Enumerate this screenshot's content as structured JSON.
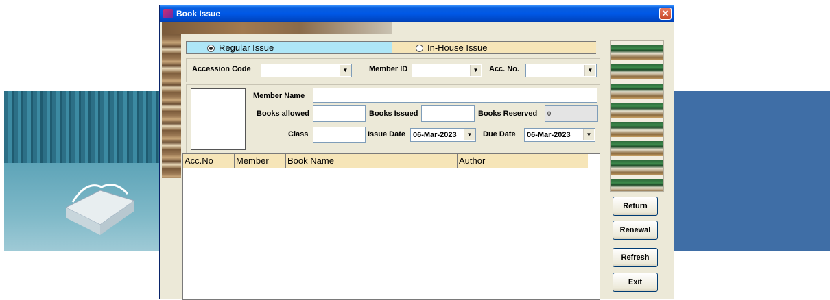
{
  "window": {
    "title": "Book Issue",
    "close_glyph": "✕"
  },
  "issue_type": {
    "regular_label": "Regular Issue",
    "inhouse_label": "In-House Issue",
    "selected": "Regular Issue"
  },
  "lookup": {
    "accession_code_label": "Accession Code",
    "accession_code_value": "",
    "member_id_label": "Member ID",
    "member_id_value": "",
    "acc_no_label": "Acc. No.",
    "acc_no_value": ""
  },
  "member": {
    "member_name_label": "Member Name",
    "member_name_value": "",
    "books_allowed_label": "Books allowed",
    "books_allowed_value": "",
    "books_issued_label": "Books Issued",
    "books_issued_value": "",
    "books_reserved_label": "Books Reserved",
    "books_reserved_value": "0",
    "class_label": "Class",
    "class_value": "",
    "issue_date_label": "Issue Date",
    "issue_date_value": "06-Mar-2023",
    "due_date_label": "Due Date",
    "due_date_value": "06-Mar-2023"
  },
  "table": {
    "columns": [
      "Acc.No",
      "Member",
      "Book Name",
      "Author"
    ],
    "rows": []
  },
  "buttons": {
    "return": "Return",
    "renewal": "Renewal",
    "refresh": "Refresh",
    "exit": "Exit"
  },
  "colors": {
    "titlebar": "#0058e6",
    "window_bg": "#ece9d8",
    "regular_tab": "#aee6f7",
    "inhouse_tab": "#f6e5b8",
    "desktop_right": "#3f6ea6"
  },
  "icons": {
    "app": "books-icon",
    "combo_arrow": "chevron-down-icon"
  }
}
